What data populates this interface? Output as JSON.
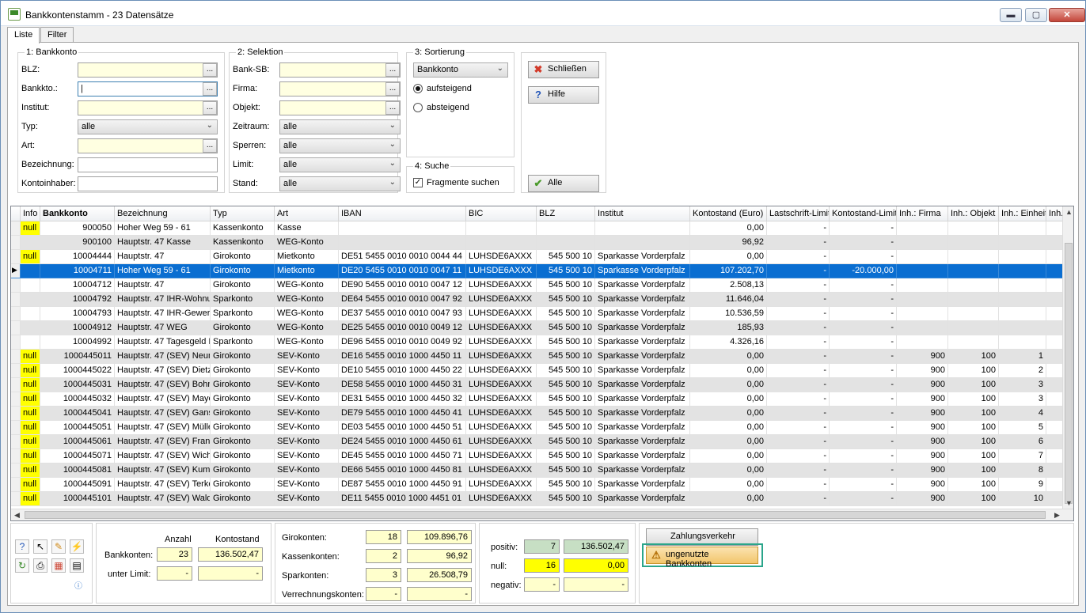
{
  "window": {
    "title": "Bankkontenstamm - 23 Datensätze",
    "min": "▬",
    "max": "▢",
    "close": "✕"
  },
  "tabs": [
    "Liste",
    "Filter"
  ],
  "bankkonto_group": {
    "title": "1: Bankkonto",
    "fields": [
      {
        "label": "BLZ:",
        "value": "",
        "kind": "lookup",
        "yellow": true
      },
      {
        "label": "Bankkto.:",
        "value": "|",
        "kind": "lookup",
        "yellow": false
      },
      {
        "label": "Institut:",
        "value": "",
        "kind": "lookup",
        "yellow": true
      },
      {
        "label": "Typ:",
        "value": "alle",
        "kind": "select"
      },
      {
        "label": "Art:",
        "value": "",
        "kind": "lookup",
        "yellow": true
      },
      {
        "label": "Bezeichnung:",
        "value": "",
        "kind": "text"
      },
      {
        "label": "Kontoinhaber:",
        "value": "",
        "kind": "text"
      }
    ]
  },
  "selektion_group": {
    "title": "2: Selektion",
    "fields": [
      {
        "label": "Bank-SB:",
        "value": "",
        "kind": "lookup"
      },
      {
        "label": "Firma:",
        "value": "",
        "kind": "lookup"
      },
      {
        "label": "Objekt:",
        "value": "",
        "kind": "lookup"
      },
      {
        "label": "Zeitraum:",
        "value": "alle",
        "kind": "select"
      },
      {
        "label": "Sperren:",
        "value": "alle",
        "kind": "select"
      },
      {
        "label": "Limit:",
        "value": "alle",
        "kind": "select"
      },
      {
        "label": "Stand:",
        "value": "alle",
        "kind": "select"
      }
    ]
  },
  "sortierung_group": {
    "title": "3: Sortierung",
    "selected": "Bankkonto",
    "asc": "aufsteigend",
    "desc": "absteigend"
  },
  "suche_group": {
    "title": "4: Suche",
    "fragment": "Fragmente suchen"
  },
  "buttons": {
    "close": "Schließen",
    "help": "Hilfe",
    "all": "Alle"
  },
  "table": {
    "headers": [
      "Info",
      "Bankkonto",
      "Bezeichnung",
      "Typ",
      "Art",
      "IBAN",
      "BIC",
      "BLZ",
      "Institut",
      "Kontostand (Euro)",
      "Lastschrift-Limit",
      "Kontostand-Limit",
      "Inh.: Firma",
      "Inh.: Objekt",
      "Inh.: Einheit",
      "Inh."
    ],
    "rows": [
      [
        "null",
        "900050",
        "Hoher Weg 59 - 61",
        "Kassenkonto",
        "Kasse",
        "",
        "",
        "",
        "",
        "0,00",
        "-",
        "-",
        "",
        "",
        "",
        ""
      ],
      [
        "",
        "900100",
        "Hauptstr. 47 Kasse",
        "Kassenkonto",
        "WEG-Konto",
        "",
        "",
        "",
        "",
        "96,92",
        "-",
        "-",
        "",
        "",
        "",
        ""
      ],
      [
        "null",
        "10004444",
        "Hauptstr. 47",
        "Girokonto",
        "Mietkonto",
        "DE51 5455 0010 0010 0044 44",
        "LUHSDE6AXXX",
        "545 500 10",
        "Sparkasse Vorderpfalz",
        "0,00",
        "-",
        "-",
        "",
        "",
        "",
        ""
      ],
      [
        "",
        "10004711",
        "Hoher Weg 59 - 61",
        "Girokonto",
        "Mietkonto",
        "DE20 5455 0010 0010 0047 11",
        "LUHSDE6AXXX",
        "545 500 10",
        "Sparkasse Vorderpfalz",
        "107.202,70",
        "-",
        "-20.000,00",
        "",
        "",
        "",
        ""
      ],
      [
        "",
        "10004712",
        "Hauptstr. 47",
        "Girokonto",
        "WEG-Konto",
        "DE90 5455 0010 0010 0047 12",
        "LUHSDE6AXXX",
        "545 500 10",
        "Sparkasse Vorderpfalz",
        "2.508,13",
        "-",
        "-",
        "",
        "",
        "",
        ""
      ],
      [
        "",
        "10004792",
        "Hauptstr. 47 IHR-Wohnu",
        "Sparkonto",
        "WEG-Konto",
        "DE64 5455 0010 0010 0047 92",
        "LUHSDE6AXXX",
        "545 500 10",
        "Sparkasse Vorderpfalz",
        "11.646,04",
        "-",
        "-",
        "",
        "",
        "",
        ""
      ],
      [
        "",
        "10004793",
        "Hauptstr. 47 IHR-Gewert",
        "Sparkonto",
        "WEG-Konto",
        "DE37 5455 0010 0010 0047 93",
        "LUHSDE6AXXX",
        "545 500 10",
        "Sparkasse Vorderpfalz",
        "10.536,59",
        "-",
        "-",
        "",
        "",
        "",
        ""
      ],
      [
        "",
        "10004912",
        "Hauptstr. 47 WEG",
        "Girokonto",
        "WEG-Konto",
        "DE25 5455 0010 0010 0049 12",
        "LUHSDE6AXXX",
        "545 500 10",
        "Sparkasse Vorderpfalz",
        "185,93",
        "-",
        "-",
        "",
        "",
        "",
        ""
      ],
      [
        "",
        "10004992",
        "Hauptstr. 47 Tagesgeld I",
        "Sparkonto",
        "WEG-Konto",
        "DE96 5455 0010 0010 0049 92",
        "LUHSDE6AXXX",
        "545 500 10",
        "Sparkasse Vorderpfalz",
        "4.326,16",
        "-",
        "-",
        "",
        "",
        "",
        ""
      ],
      [
        "null",
        "1000445011",
        "Hauptstr. 47 (SEV) Neum",
        "Girokonto",
        "SEV-Konto",
        "DE16 5455 0010 1000 4450 11",
        "LUHSDE6AXXX",
        "545 500 10",
        "Sparkasse Vorderpfalz",
        "0,00",
        "-",
        "-",
        "900",
        "100",
        "1",
        ""
      ],
      [
        "null",
        "1000445022",
        "Hauptstr. 47 (SEV) Dietz",
        "Girokonto",
        "SEV-Konto",
        "DE10 5455 0010 1000 4450 22",
        "LUHSDE6AXXX",
        "545 500 10",
        "Sparkasse Vorderpfalz",
        "0,00",
        "-",
        "-",
        "900",
        "100",
        "2",
        ""
      ],
      [
        "null",
        "1000445031",
        "Hauptstr. 47 (SEV) Bohn",
        "Girokonto",
        "SEV-Konto",
        "DE58 5455 0010 1000 4450 31",
        "LUHSDE6AXXX",
        "545 500 10",
        "Sparkasse Vorderpfalz",
        "0,00",
        "-",
        "-",
        "900",
        "100",
        "3",
        ""
      ],
      [
        "null",
        "1000445032",
        "Hauptstr. 47 (SEV) Maye",
        "Girokonto",
        "SEV-Konto",
        "DE31 5455 0010 1000 4450 32",
        "LUHSDE6AXXX",
        "545 500 10",
        "Sparkasse Vorderpfalz",
        "0,00",
        "-",
        "-",
        "900",
        "100",
        "3",
        ""
      ],
      [
        "null",
        "1000445041",
        "Hauptstr. 47 (SEV) Gans",
        "Girokonto",
        "SEV-Konto",
        "DE79 5455 0010 1000 4450 41",
        "LUHSDE6AXXX",
        "545 500 10",
        "Sparkasse Vorderpfalz",
        "0,00",
        "-",
        "-",
        "900",
        "100",
        "4",
        ""
      ],
      [
        "null",
        "1000445051",
        "Hauptstr. 47 (SEV) Mülle",
        "Girokonto",
        "SEV-Konto",
        "DE03 5455 0010 1000 4450 51",
        "LUHSDE6AXXX",
        "545 500 10",
        "Sparkasse Vorderpfalz",
        "0,00",
        "-",
        "-",
        "900",
        "100",
        "5",
        ""
      ],
      [
        "null",
        "1000445061",
        "Hauptstr. 47 (SEV) Frank",
        "Girokonto",
        "SEV-Konto",
        "DE24 5455 0010 1000 4450 61",
        "LUHSDE6AXXX",
        "545 500 10",
        "Sparkasse Vorderpfalz",
        "0,00",
        "-",
        "-",
        "900",
        "100",
        "6",
        ""
      ],
      [
        "null",
        "1000445071",
        "Hauptstr. 47 (SEV) Wich",
        "Girokonto",
        "SEV-Konto",
        "DE45 5455 0010 1000 4450 71",
        "LUHSDE6AXXX",
        "545 500 10",
        "Sparkasse Vorderpfalz",
        "0,00",
        "-",
        "-",
        "900",
        "100",
        "7",
        ""
      ],
      [
        "null",
        "1000445081",
        "Hauptstr. 47 (SEV) Kumn",
        "Girokonto",
        "SEV-Konto",
        "DE66 5455 0010 1000 4450 81",
        "LUHSDE6AXXX",
        "545 500 10",
        "Sparkasse Vorderpfalz",
        "0,00",
        "-",
        "-",
        "900",
        "100",
        "8",
        ""
      ],
      [
        "null",
        "1000445091",
        "Hauptstr. 47 (SEV) Terke",
        "Girokonto",
        "SEV-Konto",
        "DE87 5455 0010 1000 4450 91",
        "LUHSDE6AXXX",
        "545 500 10",
        "Sparkasse Vorderpfalz",
        "0,00",
        "-",
        "-",
        "900",
        "100",
        "9",
        ""
      ],
      [
        "null",
        "1000445101",
        "Hauptstr. 47 (SEV) Wald",
        "Girokonto",
        "SEV-Konto",
        "DE11 5455 0010 1000 4451 01",
        "LUHSDE6AXXX",
        "545 500 10",
        "Sparkasse Vorderpfalz",
        "0,00",
        "-",
        "-",
        "900",
        "100",
        "10",
        ""
      ]
    ]
  },
  "summary": {
    "col_anzahl": "Anzahl",
    "col_kontostand": "Kontostand",
    "bankkonten_label": "Bankkonten:",
    "bankkonten_count": "23",
    "bankkonten_sum": "136.502,47",
    "unterlimit_label": "unter Limit:",
    "unterlimit_count": "-",
    "unterlimit_sum": "-",
    "types": [
      {
        "label": "Girokonten:",
        "count": "18",
        "sum": "109.896,76"
      },
      {
        "label": "Kassenkonten:",
        "count": "2",
        "sum": "96,92"
      },
      {
        "label": "Sparkonten:",
        "count": "3",
        "sum": "26.508,79"
      },
      {
        "label": "Verrechnungskonten:",
        "count": "-",
        "sum": "-"
      }
    ],
    "signs": [
      {
        "label": "positiv:",
        "count": "7",
        "sum": "136.502,47",
        "color": "#c7dfc4"
      },
      {
        "label": "null:",
        "count": "16",
        "sum": "0,00",
        "color": "#ffff00"
      },
      {
        "label": "negativ:",
        "count": "-",
        "sum": "-",
        "color": "#ffffcc"
      }
    ],
    "zahlungsverkehr": "Zahlungsverkehr",
    "ungenutzte": "ungenutzte Bankkonten"
  },
  "accent": {
    "selection": "#0a6ed1",
    "null_badge": "#ffff00",
    "highlight_frame": "#2aa58a"
  }
}
